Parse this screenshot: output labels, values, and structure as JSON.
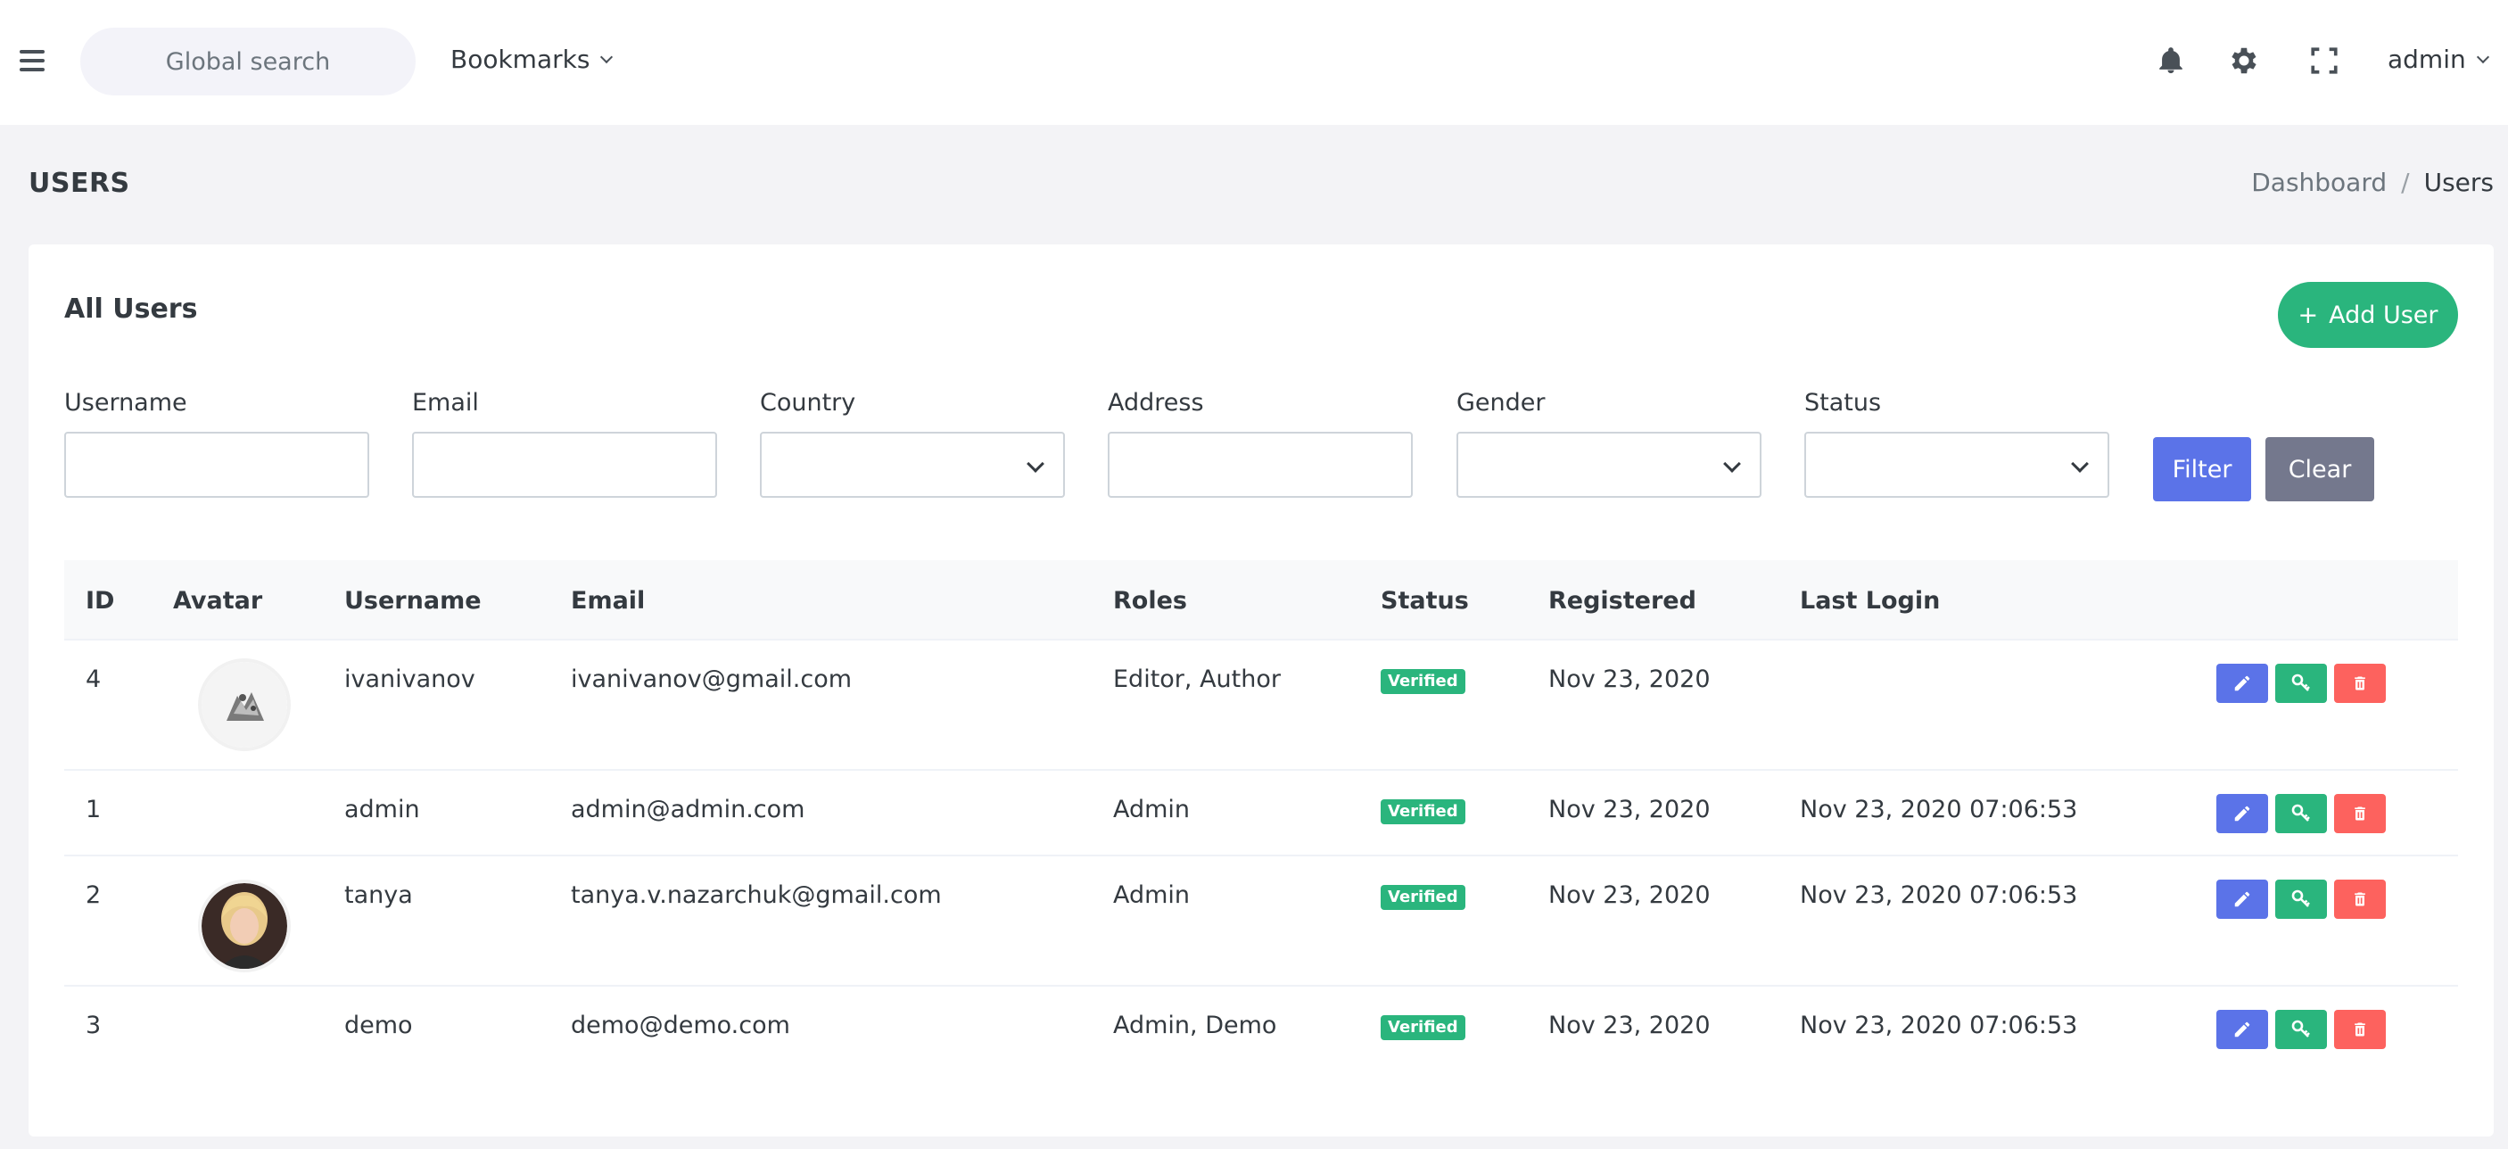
{
  "topbar": {
    "search_placeholder": "Global search",
    "bookmarks_label": "Bookmarks",
    "user_label": "admin"
  },
  "page": {
    "title": "USERS",
    "breadcrumb": {
      "parent": "Dashboard",
      "separator": "/",
      "current": "Users"
    }
  },
  "card": {
    "title": "All Users",
    "add_user_label": "Add User",
    "add_user_icon": "+"
  },
  "filters": {
    "username_label": "Username",
    "email_label": "Email",
    "country_label": "Country",
    "address_label": "Address",
    "gender_label": "Gender",
    "status_label": "Status",
    "filter_button": "Filter",
    "clear_button": "Clear"
  },
  "table": {
    "headers": {
      "id": "ID",
      "avatar": "Avatar",
      "username": "Username",
      "email": "Email",
      "roles": "Roles",
      "status": "Status",
      "registered": "Registered",
      "last_login": "Last Login"
    },
    "rows": [
      {
        "id": "4",
        "username": "ivanivanov",
        "email": "ivanivanov@gmail.com",
        "roles": "Editor, Author",
        "status": "Verified",
        "registered": "Nov 23, 2020",
        "last_login": "",
        "avatar": "illustration"
      },
      {
        "id": "1",
        "username": "admin",
        "email": "admin@admin.com",
        "roles": "Admin",
        "status": "Verified",
        "registered": "Nov 23, 2020",
        "last_login": "Nov 23, 2020 07:06:53",
        "avatar": ""
      },
      {
        "id": "2",
        "username": "tanya",
        "email": "tanya.v.nazarchuk@gmail.com",
        "roles": "Admin",
        "status": "Verified",
        "registered": "Nov 23, 2020",
        "last_login": "Nov 23, 2020 07:06:53",
        "avatar": "photo"
      },
      {
        "id": "3",
        "username": "demo",
        "email": "demo@demo.com",
        "roles": "Admin, Demo",
        "status": "Verified",
        "registered": "Nov 23, 2020",
        "last_login": "Nov 23, 2020 07:06:53",
        "avatar": ""
      }
    ]
  },
  "colors": {
    "primary": "#5b73e8",
    "success": "#2ab57d",
    "danger": "#fd625e",
    "secondary": "#74788d",
    "background": "#f3f3f6"
  },
  "icons": {
    "menu": "hamburger-icon",
    "notifications": "bell-icon",
    "settings": "gear-icon",
    "fullscreen": "fullscreen-icon",
    "edit": "pencil-icon",
    "permissions": "key-icon",
    "delete": "trash-icon"
  }
}
